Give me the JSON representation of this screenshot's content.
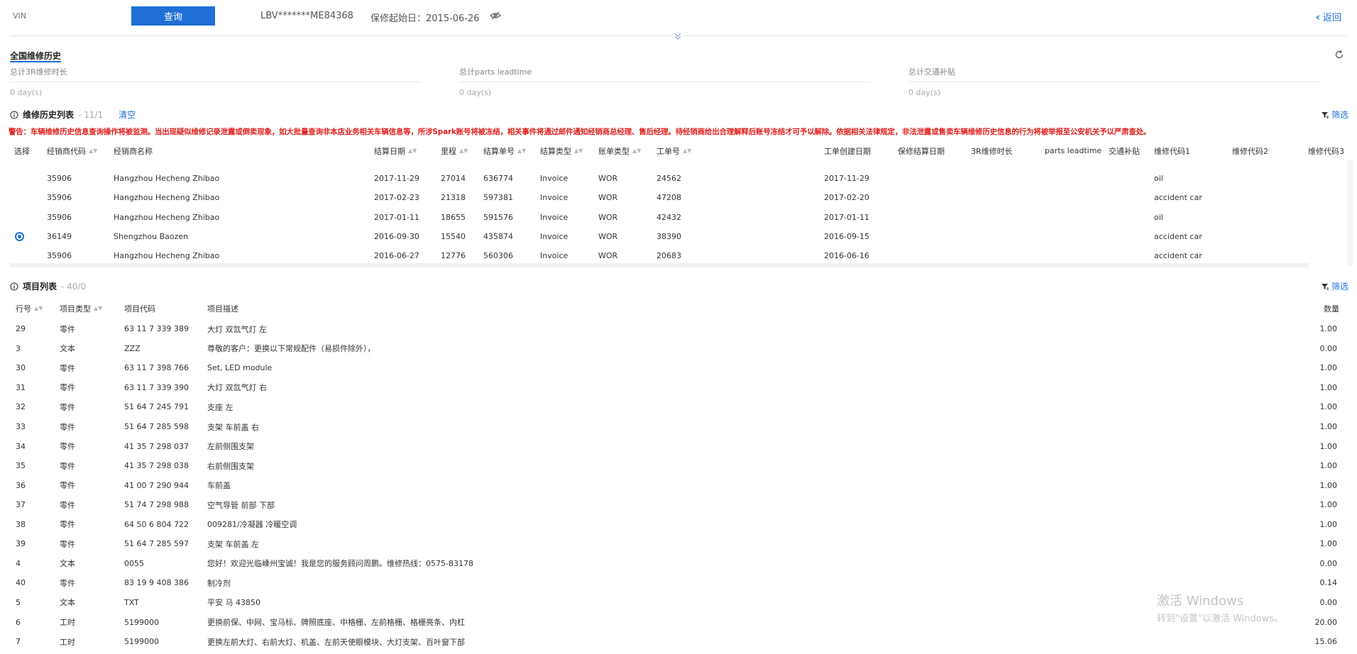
{
  "topbar": {
    "vin_input_value": "",
    "vin_placeholder": "VIN",
    "query_label": "查询",
    "vin_text": "LBV*******ME84368",
    "warranty_text": "保修起始日：2015-06-26",
    "back_label": "返回"
  },
  "summary": {
    "title": "全国维修历史",
    "metrics": [
      {
        "label": "总计3R维修时长",
        "value": "0 day(s)"
      },
      {
        "label": "总计parts leadtime",
        "value": "0 day(s)"
      },
      {
        "label": "总计交通补贴",
        "value": "0 day(s)"
      }
    ]
  },
  "history": {
    "title": "维修历史列表",
    "count": " - 11/1",
    "clear_label": "清空",
    "filter_label": "筛选",
    "warning": "警告：车辆维修历史信息查询操作将被监测。当出现疑似维修记录泄露或倒卖现象，如大批量查询非本店业务相关车辆信息等，所涉Spark账号将被冻结，相关事件将通过邮件通知经销商总经理、售后经理。待经销商给出合理解释后账号冻结才可予以解除。依据相关法律规定，非法泄露或售卖车辆维修历史信息的行为将被举报至公安机关予以严肃查处。",
    "columns": [
      "选择",
      "经销商代码",
      "经销商名称",
      "结算日期",
      "里程",
      "结算单号",
      "结算类型",
      "账单类型",
      "工单号",
      "工单创建日期",
      "保修结算日期",
      "3R维修时长",
      "parts leadtime",
      "交通补贴",
      "维修代码1",
      "维修代码2",
      "维修代码3"
    ],
    "rows": [
      {
        "selected": false,
        "dealer_code": "35906",
        "dealer_name": "Hangzhou Hecheng Zhibao",
        "settle_date": "2017-11-29",
        "mileage": "27014",
        "settle_no": "636774",
        "settle_type": "Invoice",
        "bill_type": "WOR",
        "ro_no": "24562",
        "ro_date": "2017-11-29",
        "code1": "oil"
      },
      {
        "selected": false,
        "dealer_code": "35906",
        "dealer_name": "Hangzhou Hecheng Zhibao",
        "settle_date": "2017-02-23",
        "mileage": "21318",
        "settle_no": "597381",
        "settle_type": "Invoice",
        "bill_type": "WOR",
        "ro_no": "47208",
        "ro_date": "2017-02-20",
        "code1": "accident car"
      },
      {
        "selected": false,
        "dealer_code": "35906",
        "dealer_name": "Hangzhou Hecheng Zhibao",
        "settle_date": "2017-01-11",
        "mileage": "18655",
        "settle_no": "591576",
        "settle_type": "Invoice",
        "bill_type": "WOR",
        "ro_no": "42432",
        "ro_date": "2017-01-11",
        "code1": "oil"
      },
      {
        "selected": true,
        "dealer_code": "36149",
        "dealer_name": "Shengzhou Baozen",
        "settle_date": "2016-09-30",
        "mileage": "15540",
        "settle_no": "435874",
        "settle_type": "Invoice",
        "bill_type": "WOR",
        "ro_no": "38390",
        "ro_date": "2016-09-15",
        "code1": "accident car"
      },
      {
        "selected": false,
        "dealer_code": "35906",
        "dealer_name": "Hangzhou Hecheng Zhibao",
        "settle_date": "2016-06-27",
        "mileage": "12776",
        "settle_no": "560306",
        "settle_type": "Invoice",
        "bill_type": "WOR",
        "ro_no": "20683",
        "ro_date": "2016-06-16",
        "code1": "accident car"
      }
    ]
  },
  "items": {
    "title": "项目列表",
    "count": " - 40/0",
    "filter_label": "筛选",
    "columns": [
      "行号",
      "项目类型",
      "项目代码",
      "项目描述",
      "数量"
    ],
    "rows": [
      {
        "line": "29",
        "type": "零件",
        "code": "63 11 7 339 389",
        "desc": "大灯 双氙气灯 左",
        "qty": "1.00"
      },
      {
        "line": "3",
        "type": "文本",
        "code": "ZZZ",
        "desc": "尊敬的客户：更换以下常规配件（易损件除外），",
        "qty": "0.00"
      },
      {
        "line": "30",
        "type": "零件",
        "code": "63 11 7 398 766",
        "desc": "Set, LED module",
        "qty": "1.00"
      },
      {
        "line": "31",
        "type": "零件",
        "code": "63 11 7 339 390",
        "desc": "大灯 双氙气灯 右",
        "qty": "1.00"
      },
      {
        "line": "32",
        "type": "零件",
        "code": "51 64 7 245 791",
        "desc": "支座 左",
        "qty": "1.00"
      },
      {
        "line": "33",
        "type": "零件",
        "code": "51 64 7 285 598",
        "desc": "支架 车前盖 右",
        "qty": "1.00"
      },
      {
        "line": "34",
        "type": "零件",
        "code": "41 35 7 298 037",
        "desc": "左前侧围支架",
        "qty": "1.00"
      },
      {
        "line": "35",
        "type": "零件",
        "code": "41 35 7 298 038",
        "desc": "右前侧围支架",
        "qty": "1.00"
      },
      {
        "line": "36",
        "type": "零件",
        "code": "41 00 7 290 944",
        "desc": "车前盖",
        "qty": "1.00"
      },
      {
        "line": "37",
        "type": "零件",
        "code": "51 74 7 298 988",
        "desc": "空气导管 前部 下部",
        "qty": "1.00"
      },
      {
        "line": "38",
        "type": "零件",
        "code": "64 50 6 804 722",
        "desc": "009281/冷凝器 冷暖空调",
        "qty": "1.00"
      },
      {
        "line": "39",
        "type": "零件",
        "code": "51 64 7 285 597",
        "desc": "支架 车前盖 左",
        "qty": "1.00"
      },
      {
        "line": "4",
        "type": "文本",
        "code": "0055",
        "desc": "您好！欢迎光临嵊州宝诚！我是您的服务顾问周鹏。维修热线：0575-83178",
        "qty": "0.00"
      },
      {
        "line": "40",
        "type": "零件",
        "code": "83 19 9 408 386",
        "desc": "制冷剂",
        "qty": "0.14"
      },
      {
        "line": "5",
        "type": "文本",
        "code": "TXT",
        "desc": "平安 马 43850",
        "qty": "0.00"
      },
      {
        "line": "6",
        "type": "工时",
        "code": "5199000",
        "desc": "更换前保、中网、宝马标、牌照底座、中格栅、左前格栅、格栅亮条、内杠",
        "qty": "20.00"
      },
      {
        "line": "7",
        "type": "工时",
        "code": "5199000",
        "desc": "更换左前大灯、右前大灯、机盖、左前天使眼模块、大灯支架、百叶窗下部",
        "qty": "15.06"
      }
    ]
  },
  "watermark": {
    "line1": "激活 Windows",
    "line2": "转到\"设置\"以激活 Windows。"
  }
}
